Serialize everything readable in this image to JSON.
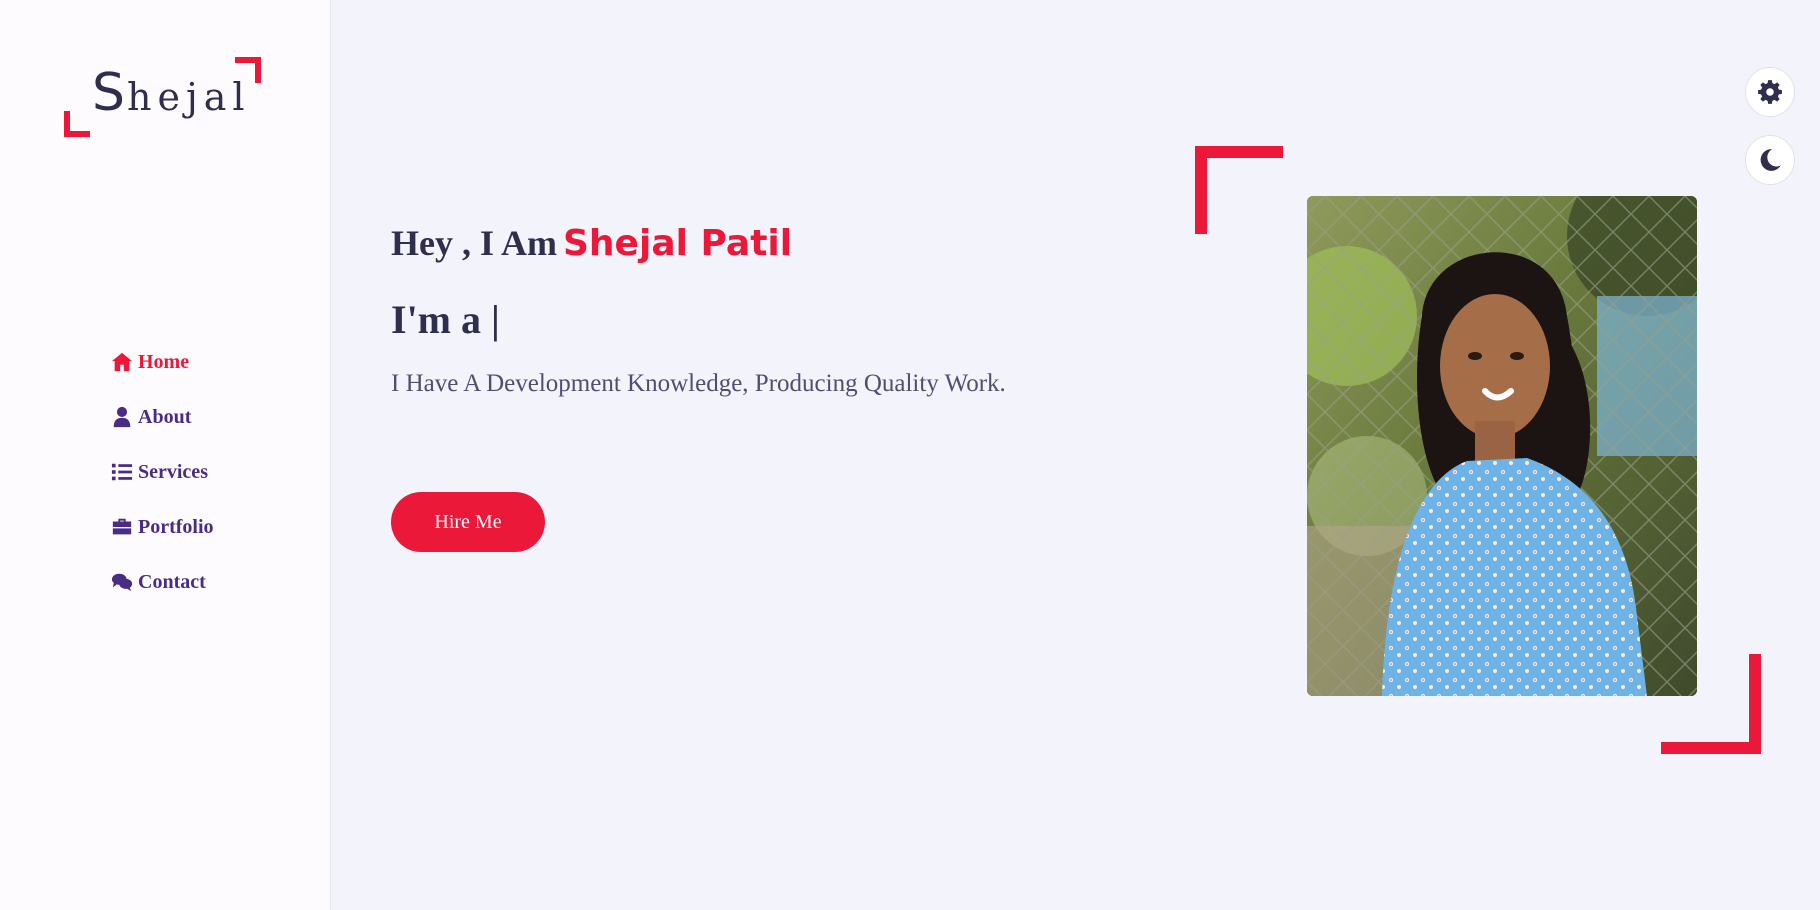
{
  "logo": {
    "first_letter": "S",
    "rest": "hejal"
  },
  "nav": {
    "items": [
      {
        "label": "Home",
        "icon": "home-icon",
        "active": true
      },
      {
        "label": "About",
        "icon": "user-icon",
        "active": false
      },
      {
        "label": "Services",
        "icon": "list-icon",
        "active": false
      },
      {
        "label": "Portfolio",
        "icon": "briefcase-icon",
        "active": false
      },
      {
        "label": "Contact",
        "icon": "chat-icon",
        "active": false
      }
    ]
  },
  "hero": {
    "greeting_prefix": "Hey , I Am",
    "name": "Shejal Patil",
    "role": "I'm a |",
    "tagline": "I Have A Development Knowledge, Producing Quality Work.",
    "hire_label": "Hire Me"
  },
  "controls": {
    "settings_icon": "gear-icon",
    "theme_icon": "moon-icon"
  },
  "colors": {
    "accent": "#ec1839",
    "nav_text": "#4b2c84",
    "heading": "#302e4d",
    "background": "#f2f3fb",
    "sidebar": "#fdfbfe"
  }
}
